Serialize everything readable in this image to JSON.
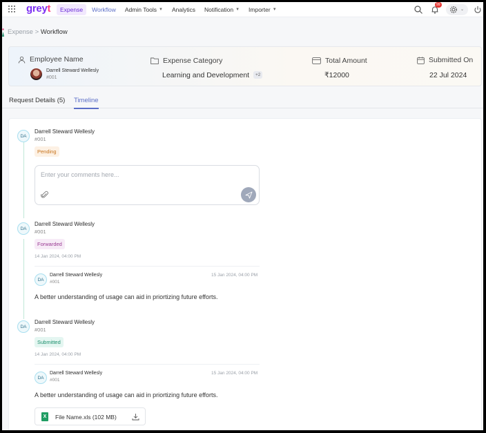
{
  "brand": {
    "logo": "greyt"
  },
  "nav": {
    "items": [
      {
        "label": "Expense",
        "state": "pill"
      },
      {
        "label": "Workflow",
        "state": "active"
      },
      {
        "label": "Admin Tools",
        "chevron": true
      },
      {
        "label": "Analytics"
      },
      {
        "label": "Notification",
        "chevron": true
      },
      {
        "label": "Importer",
        "chevron": true
      }
    ],
    "notification_count": "99"
  },
  "breadcrumb": {
    "parent": "Expense",
    "separator": ">",
    "current": "Workflow"
  },
  "summary": {
    "employee": {
      "label": "Employee Name",
      "name": "Darrell Steward Wellesly",
      "id": "#001"
    },
    "category": {
      "label": "Expense Category",
      "value": "Learning and Development",
      "extra": "+2"
    },
    "amount": {
      "label": "Total Amount",
      "value": "₹12000"
    },
    "submitted": {
      "label": "Submitted On",
      "value": "22 Jul 2024"
    }
  },
  "tabs": [
    {
      "label": "Request Details (5)",
      "active": false
    },
    {
      "label": "Timeline",
      "active": true
    }
  ],
  "timeline": [
    {
      "initials": "DA",
      "name": "Darrell Steward Wellesly",
      "id": "#001",
      "status": "Pending",
      "comment_placeholder": "Enter your comments here..."
    },
    {
      "initials": "DA",
      "name": "Darrell Steward Wellesly",
      "id": "#001",
      "status": "Forwarded",
      "date": "14 Jan 2024, 04:00 PM",
      "comment": {
        "initials": "DA",
        "name": "Darrell Steward Wellesly",
        "id": "#001",
        "date": "15 Jan 2024, 04:00 PM",
        "text": "A better understanding of usage can aid in priortizing future efforts."
      }
    },
    {
      "initials": "DA",
      "name": "Darrell Steward Wellesly",
      "id": "#001",
      "status": "Submitted",
      "date": "14 Jan 2024, 04:00 PM",
      "comment": {
        "initials": "DA",
        "name": "Darrell Steward Wellesly",
        "id": "#001",
        "date": "15 Jan 2024, 04:00 PM",
        "text": "A better understanding of usage can aid in priortizing future efforts."
      },
      "attachment": {
        "name": "File Name.xls (102 MB)",
        "icon": "excel-file-icon"
      }
    }
  ],
  "colors": {
    "accent": "#5b6ec7",
    "brand": "#7b2ff2",
    "pending": "#c7741d",
    "forwarded": "#9a3b93",
    "submitted": "#1c8f6c"
  }
}
